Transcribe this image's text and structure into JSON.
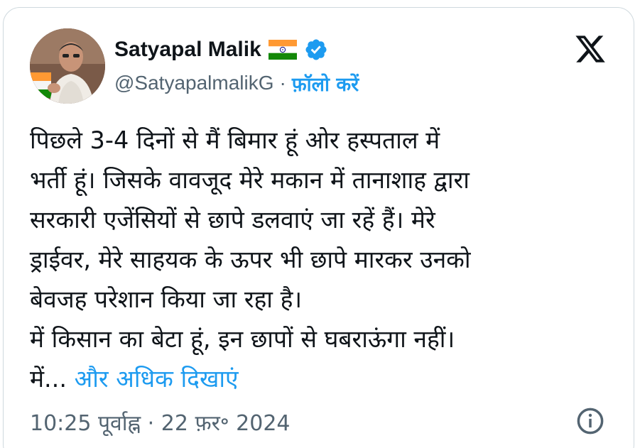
{
  "author": {
    "name": "Satyapal Malik",
    "handle": "@SatyapalmalikG",
    "separator": "·",
    "follow_label": "फ़ॉलो करें",
    "flag_icon": "india-flag-icon",
    "verified_icon": "verified-badge-icon"
  },
  "platform_icon": "x-logo-icon",
  "tweet": {
    "lines": [
      "पिछले 3-4 दिनों से मैं बिमार हूं ओर हस्पताल में",
      "भर्ती हूं। जिसके वावजूद मेरे मकान में तानाशाह द्वारा",
      "सरकारी एजेंसियों से छापे डलवाएं जा रहें हैं। मेरे",
      "ड्राईवर, मेरे साहयक के ऊपर भी छापे मारकर उनको",
      "बेवजह परेशान किया जा रहा है।",
      "में किसान का बेटा हूं, इन छापों से घबराऊंगा नहीं।"
    ],
    "last_line_prefix": "में...",
    "show_more_label": "और अधिक दिखाएं"
  },
  "timestamp": "10:25 पूर्वाह्न · 22 फ़र॰ 2024",
  "info_icon": "info-icon",
  "colors": {
    "accent": "#1d9bf0",
    "text": "#0f1419",
    "secondary": "#536471",
    "border": "#cfd9de"
  }
}
